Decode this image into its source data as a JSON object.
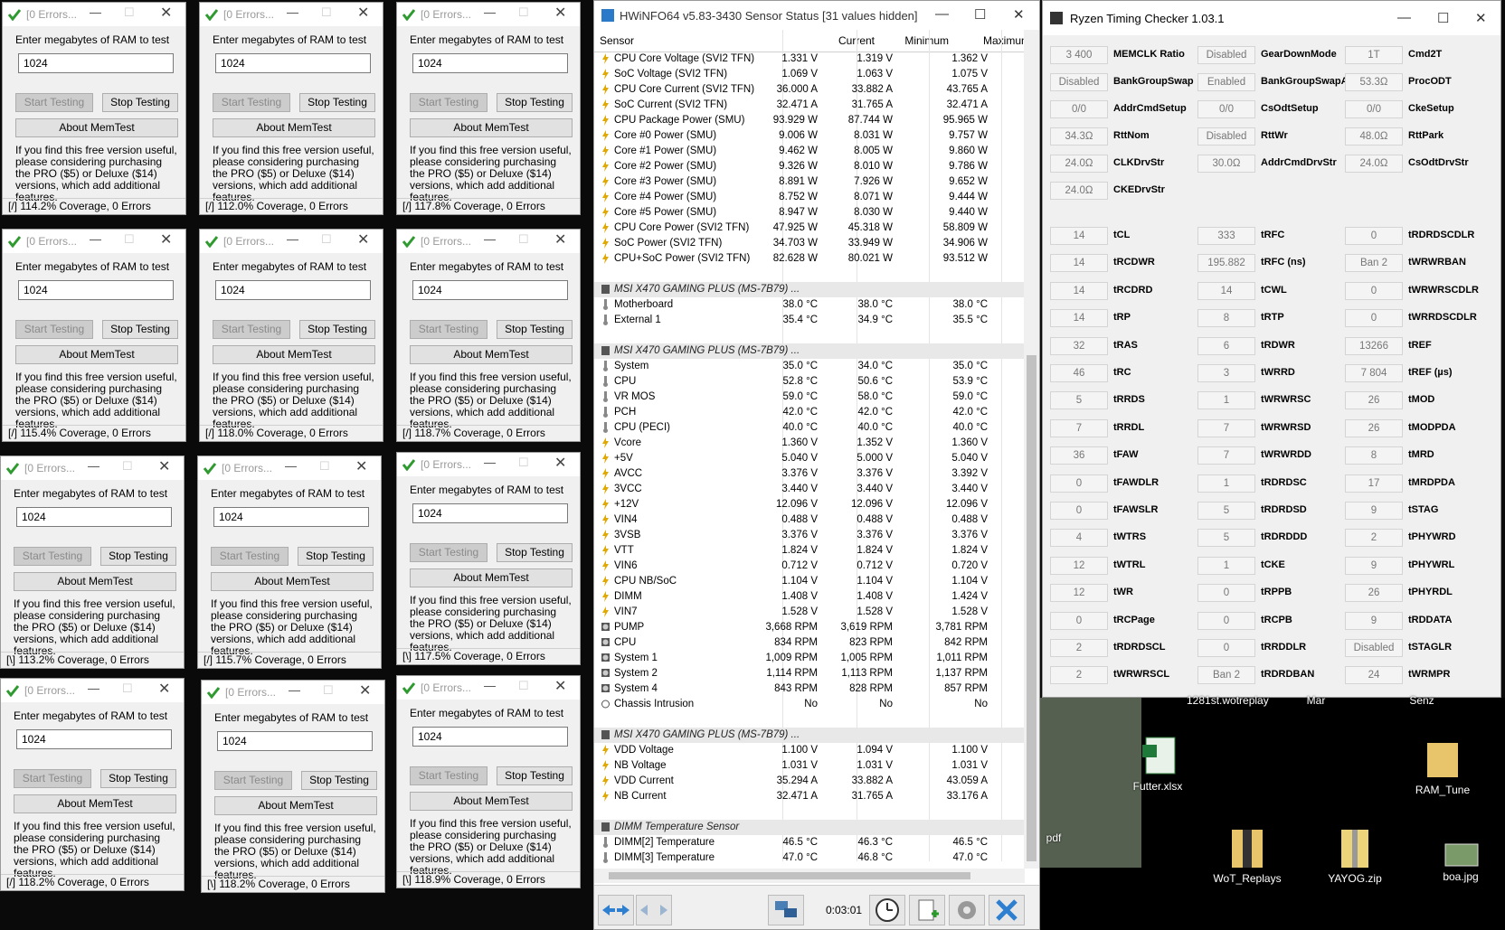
{
  "memtest": {
    "title": "[0 Errors...",
    "prompt": "Enter megabytes of RAM to test",
    "value": "1024",
    "start_label": "Start Testing",
    "stop_label": "Stop Testing",
    "about_label": "About MemTest",
    "info": "If you find this free version useful, please considering purchasing the PRO ($5) or Deluxe ($14) versions, which add additional features.",
    "windows": [
      {
        "status": "[/]  114.2% Coverage, 0 Errors"
      },
      {
        "status": "[/]  112.0% Coverage, 0 Errors"
      },
      {
        "status": "[/]  117.8% Coverage, 0 Errors"
      },
      {
        "status": "[/]  115.4% Coverage, 0 Errors"
      },
      {
        "status": "[/]  118.0% Coverage, 0 Errors"
      },
      {
        "status": "[/]  118.7% Coverage, 0 Errors"
      },
      {
        "status": "[\\]  113.2% Coverage, 0 Errors"
      },
      {
        "status": "[/]  115.7% Coverage, 0 Errors"
      },
      {
        "status": "[\\]  117.5% Coverage, 0 Errors"
      },
      {
        "status": "[/]  118.2% Coverage, 0 Errors"
      },
      {
        "status": "[\\]  118.2% Coverage, 0 Errors"
      },
      {
        "status": "[\\]  118.9% Coverage, 0 Errors"
      }
    ]
  },
  "hwinfo": {
    "title": "HWiNFO64 v5.83-3430 Sensor Status [31 values hidden]",
    "columns": {
      "sensor": "Sensor",
      "current": "Current",
      "minimum": "Minimum",
      "maximum": "Maximum"
    },
    "timer": "0:03:01",
    "rows": [
      {
        "t": "v",
        "n": "CPU Core Voltage (SVI2 TFN)",
        "c": "1.331 V",
        "mi": "1.319 V",
        "ma": "1.362 V"
      },
      {
        "t": "v",
        "n": "SoC Voltage (SVI2 TFN)",
        "c": "1.069 V",
        "mi": "1.063 V",
        "ma": "1.075 V"
      },
      {
        "t": "v",
        "n": "CPU Core Current (SVI2 TFN)",
        "c": "36.000 A",
        "mi": "33.882 A",
        "ma": "43.765 A"
      },
      {
        "t": "v",
        "n": "SoC Current (SVI2 TFN)",
        "c": "32.471 A",
        "mi": "31.765 A",
        "ma": "32.471 A"
      },
      {
        "t": "v",
        "n": "CPU Package Power (SMU)",
        "c": "93.929 W",
        "mi": "87.744 W",
        "ma": "95.965 W"
      },
      {
        "t": "v",
        "n": "Core #0 Power (SMU)",
        "c": "9.006 W",
        "mi": "8.031 W",
        "ma": "9.757 W"
      },
      {
        "t": "v",
        "n": "Core #1 Power (SMU)",
        "c": "9.462 W",
        "mi": "8.005 W",
        "ma": "9.860 W"
      },
      {
        "t": "v",
        "n": "Core #2 Power (SMU)",
        "c": "9.326 W",
        "mi": "8.010 W",
        "ma": "9.786 W"
      },
      {
        "t": "v",
        "n": "Core #3 Power (SMU)",
        "c": "8.891 W",
        "mi": "7.926 W",
        "ma": "9.652 W"
      },
      {
        "t": "v",
        "n": "Core #4 Power (SMU)",
        "c": "8.752 W",
        "mi": "8.071 W",
        "ma": "9.444 W"
      },
      {
        "t": "v",
        "n": "Core #5 Power (SMU)",
        "c": "8.947 W",
        "mi": "8.030 W",
        "ma": "9.440 W"
      },
      {
        "t": "v",
        "n": "CPU Core Power (SVI2 TFN)",
        "c": "47.925 W",
        "mi": "45.318 W",
        "ma": "58.809 W"
      },
      {
        "t": "v",
        "n": "SoC Power (SVI2 TFN)",
        "c": "34.703 W",
        "mi": "33.949 W",
        "ma": "34.906 W"
      },
      {
        "t": "v",
        "n": "CPU+SoC Power (SVI2 TFN)",
        "c": "82.628 W",
        "mi": "80.021 W",
        "ma": "93.512 W"
      },
      {
        "t": "e"
      },
      {
        "t": "g",
        "n": "MSI X470 GAMING PLUS (MS-7B79) ..."
      },
      {
        "t": "t",
        "n": "Motherboard",
        "c": "38.0 °C",
        "mi": "38.0 °C",
        "ma": "38.0 °C"
      },
      {
        "t": "t",
        "n": "External 1",
        "c": "35.4 °C",
        "mi": "34.9 °C",
        "ma": "35.5 °C"
      },
      {
        "t": "e"
      },
      {
        "t": "g",
        "n": "MSI X470 GAMING PLUS (MS-7B79) ..."
      },
      {
        "t": "t",
        "n": "System",
        "c": "35.0 °C",
        "mi": "34.0 °C",
        "ma": "35.0 °C"
      },
      {
        "t": "t",
        "n": "CPU",
        "c": "52.8 °C",
        "mi": "50.6 °C",
        "ma": "53.9 °C"
      },
      {
        "t": "t",
        "n": "VR MOS",
        "c": "59.0 °C",
        "mi": "58.0 °C",
        "ma": "59.0 °C"
      },
      {
        "t": "t",
        "n": "PCH",
        "c": "42.0 °C",
        "mi": "42.0 °C",
        "ma": "42.0 °C"
      },
      {
        "t": "t",
        "n": "CPU (PECI)",
        "c": "40.0 °C",
        "mi": "40.0 °C",
        "ma": "40.0 °C"
      },
      {
        "t": "v",
        "n": "Vcore",
        "c": "1.360 V",
        "mi": "1.352 V",
        "ma": "1.360 V"
      },
      {
        "t": "v",
        "n": "+5V",
        "c": "5.040 V",
        "mi": "5.000 V",
        "ma": "5.040 V"
      },
      {
        "t": "v",
        "n": "AVCC",
        "c": "3.376 V",
        "mi": "3.376 V",
        "ma": "3.392 V"
      },
      {
        "t": "v",
        "n": "3VCC",
        "c": "3.440 V",
        "mi": "3.440 V",
        "ma": "3.440 V"
      },
      {
        "t": "v",
        "n": "+12V",
        "c": "12.096 V",
        "mi": "12.096 V",
        "ma": "12.096 V"
      },
      {
        "t": "v",
        "n": "VIN4",
        "c": "0.488 V",
        "mi": "0.488 V",
        "ma": "0.488 V"
      },
      {
        "t": "v",
        "n": "3VSB",
        "c": "3.376 V",
        "mi": "3.376 V",
        "ma": "3.376 V"
      },
      {
        "t": "v",
        "n": "VTT",
        "c": "1.824 V",
        "mi": "1.824 V",
        "ma": "1.824 V"
      },
      {
        "t": "v",
        "n": "VIN6",
        "c": "0.712 V",
        "mi": "0.712 V",
        "ma": "0.720 V"
      },
      {
        "t": "v",
        "n": "CPU NB/SoC",
        "c": "1.104 V",
        "mi": "1.104 V",
        "ma": "1.104 V"
      },
      {
        "t": "v",
        "n": "DIMM",
        "c": "1.408 V",
        "mi": "1.408 V",
        "ma": "1.424 V"
      },
      {
        "t": "v",
        "n": "VIN7",
        "c": "1.528 V",
        "mi": "1.528 V",
        "ma": "1.528 V"
      },
      {
        "t": "f",
        "n": "PUMP",
        "c": "3,668 RPM",
        "mi": "3,619 RPM",
        "ma": "3,781 RPM"
      },
      {
        "t": "f",
        "n": "CPU",
        "c": "834 RPM",
        "mi": "823 RPM",
        "ma": "842 RPM"
      },
      {
        "t": "f",
        "n": "System 1",
        "c": "1,009 RPM",
        "mi": "1,005 RPM",
        "ma": "1,011 RPM"
      },
      {
        "t": "f",
        "n": "System 2",
        "c": "1,114 RPM",
        "mi": "1,113 RPM",
        "ma": "1,137 RPM"
      },
      {
        "t": "f",
        "n": "System 4",
        "c": "843 RPM",
        "mi": "828 RPM",
        "ma": "857 RPM"
      },
      {
        "t": "o",
        "n": "Chassis Intrusion",
        "c": "No",
        "mi": "No",
        "ma": "No"
      },
      {
        "t": "e"
      },
      {
        "t": "g",
        "n": "MSI X470 GAMING PLUS (MS-7B79) ..."
      },
      {
        "t": "v",
        "n": "VDD Voltage",
        "c": "1.100 V",
        "mi": "1.094 V",
        "ma": "1.100 V"
      },
      {
        "t": "v",
        "n": "NB Voltage",
        "c": "1.031 V",
        "mi": "1.031 V",
        "ma": "1.031 V"
      },
      {
        "t": "v",
        "n": "VDD Current",
        "c": "35.294 A",
        "mi": "33.882 A",
        "ma": "43.059 A"
      },
      {
        "t": "v",
        "n": "NB Current",
        "c": "32.471 A",
        "mi": "31.765 A",
        "ma": "33.176 A"
      },
      {
        "t": "e"
      },
      {
        "t": "g",
        "n": "DIMM Temperature Sensor"
      },
      {
        "t": "t",
        "n": "DIMM[2] Temperature",
        "c": "46.5 °C",
        "mi": "46.3 °C",
        "ma": "46.5 °C"
      },
      {
        "t": "t",
        "n": "DIMM[3] Temperature",
        "c": "47.0 °C",
        "mi": "46.8 °C",
        "ma": "47.0 °C"
      }
    ]
  },
  "rtc": {
    "title": "Ryzen Timing Checker 1.03.1",
    "top": [
      [
        "3 400",
        "MEMCLK Ratio",
        "Disabled",
        "GearDownMode",
        "1T",
        "Cmd2T"
      ],
      [
        "Disabled",
        "BankGroupSwap",
        "Enabled",
        "BankGroupSwapAlt",
        "53.3Ω",
        "ProcODT"
      ],
      [
        "0/0",
        "AddrCmdSetup",
        "0/0",
        "CsOdtSetup",
        "0/0",
        "CkeSetup"
      ],
      [
        "34.3Ω",
        "RttNom",
        "Disabled",
        "RttWr",
        "48.0Ω",
        "RttPark"
      ],
      [
        "24.0Ω",
        "CLKDrvStr",
        "30.0Ω",
        "AddrCmdDrvStr",
        "24.0Ω",
        "CsOdtDrvStr"
      ],
      [
        "24.0Ω",
        "CKEDrvStr",
        "",
        "",
        "",
        ""
      ]
    ],
    "timings": [
      [
        "14",
        "tCL",
        "333",
        "tRFC",
        "0",
        "tRDRDSCDLR"
      ],
      [
        "14",
        "tRCDWR",
        "195.882",
        "tRFC (ns)",
        "Ban 2",
        "tWRWRBAN"
      ],
      [
        "14",
        "tRCDRD",
        "14",
        "tCWL",
        "0",
        "tWRWRSCDLR"
      ],
      [
        "14",
        "tRP",
        "8",
        "tRTP",
        "0",
        "tWRRDSCDLR"
      ],
      [
        "32",
        "tRAS",
        "6",
        "tRDWR",
        "13266",
        "tREF"
      ],
      [
        "46",
        "tRC",
        "3",
        "tWRRD",
        "7 804",
        "tREF (µs)"
      ],
      [
        "5",
        "tRRDS",
        "1",
        "tWRWRSC",
        "26",
        "tMOD"
      ],
      [
        "7",
        "tRRDL",
        "7",
        "tWRWRSD",
        "26",
        "tMODPDA"
      ],
      [
        "36",
        "tFAW",
        "7",
        "tWRWRDD",
        "8",
        "tMRD"
      ],
      [
        "0",
        "tFAWDLR",
        "1",
        "tRDRDSC",
        "17",
        "tMRDPDA"
      ],
      [
        "0",
        "tFAWSLR",
        "5",
        "tRDRDSD",
        "9",
        "tSTAG"
      ],
      [
        "4",
        "tWTRS",
        "5",
        "tRDRDDD",
        "2",
        "tPHYWRD"
      ],
      [
        "12",
        "tWTRL",
        "1",
        "tCKE",
        "9",
        "tPHYWRL"
      ],
      [
        "12",
        "tWR",
        "0",
        "tRPPB",
        "26",
        "tPHYRDL"
      ],
      [
        "0",
        "tRCPage",
        "0",
        "tRCPB",
        "9",
        "tRDDATA"
      ],
      [
        "2",
        "tRDRDSCL",
        "0",
        "tRRDDLR",
        "Disabled",
        "tSTAGLR"
      ],
      [
        "2",
        "tWRWRSCL",
        "Ban 2",
        "tRDRDBAN",
        "24",
        "tWRMPR"
      ]
    ]
  },
  "desktop": {
    "top_labels": [
      "1281st.wotreplay",
      "Mar",
      "Senz"
    ],
    "icons": [
      {
        "label": "Futter.xlsx",
        "icon": "excel-file-icon"
      },
      {
        "label": "RAM_Tune",
        "icon": "folder-icon"
      },
      {
        "label": "pdf",
        "icon": "pdf-file-icon"
      },
      {
        "label": "WoT_Replays",
        "icon": "zip-folder-icon"
      },
      {
        "label": "YAYOG.zip",
        "icon": "zip-folder-icon"
      },
      {
        "label": "boa.jpg",
        "icon": "image-file-icon"
      }
    ]
  }
}
